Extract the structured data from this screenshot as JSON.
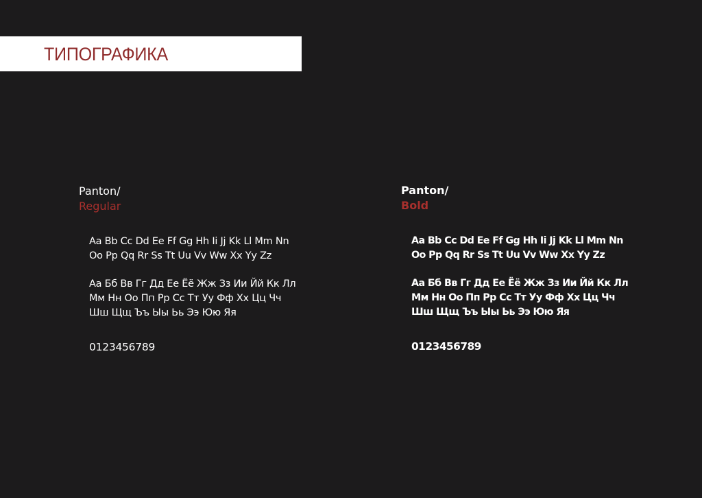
{
  "header": {
    "title": "ТИПОГРАФИКА"
  },
  "specimens": [
    {
      "font_name": "Panton/",
      "weight": "Regular",
      "latin_lines": [
        "Aa Bb Cc Dd  Ee Ff Gg Hh Ii Jj Kk Ll Mm Nn",
        "Oo Pp Qq Rr Ss Tt Uu Vv Ww Xx Yy Zz"
      ],
      "cyrillic_lines": [
        "Аа Бб Вв Гг Дд Ее Ёё Жж Зз Ии Йй Кк Лл",
        "Мм Нн Оо Пп Рр Сс Тт Уу Фф Хх Цц Чч",
        "Шш Щщ Ъъ Ыы Ьь Ээ Юю Яя"
      ],
      "digits": "0123456789"
    },
    {
      "font_name": "Panton/",
      "weight": "Bold",
      "latin_lines": [
        "Aa Bb Cc Dd  Ee Ff Gg Hh Ii Jj Kk Ll Mm Nn",
        "Oo Pp Qq Rr Ss Tt Uu Vv Ww Xx Yy Zz"
      ],
      "cyrillic_lines": [
        "Аа Бб Вв Гг Дд Ее Ёё Жж Зз Ии Йй Кк Лл",
        "Мм Нн Оо Пп Рр Сс Тт Уу Фф Хх Цц Чч",
        "Шш Щщ Ъъ Ыы Ьь Ээ Юю Яя"
      ],
      "digits": "0123456789"
    }
  ],
  "colors": {
    "background": "#1c1b1c",
    "accent": "#a8302d",
    "title_band": "#ffffff",
    "text": "#ffffff"
  }
}
